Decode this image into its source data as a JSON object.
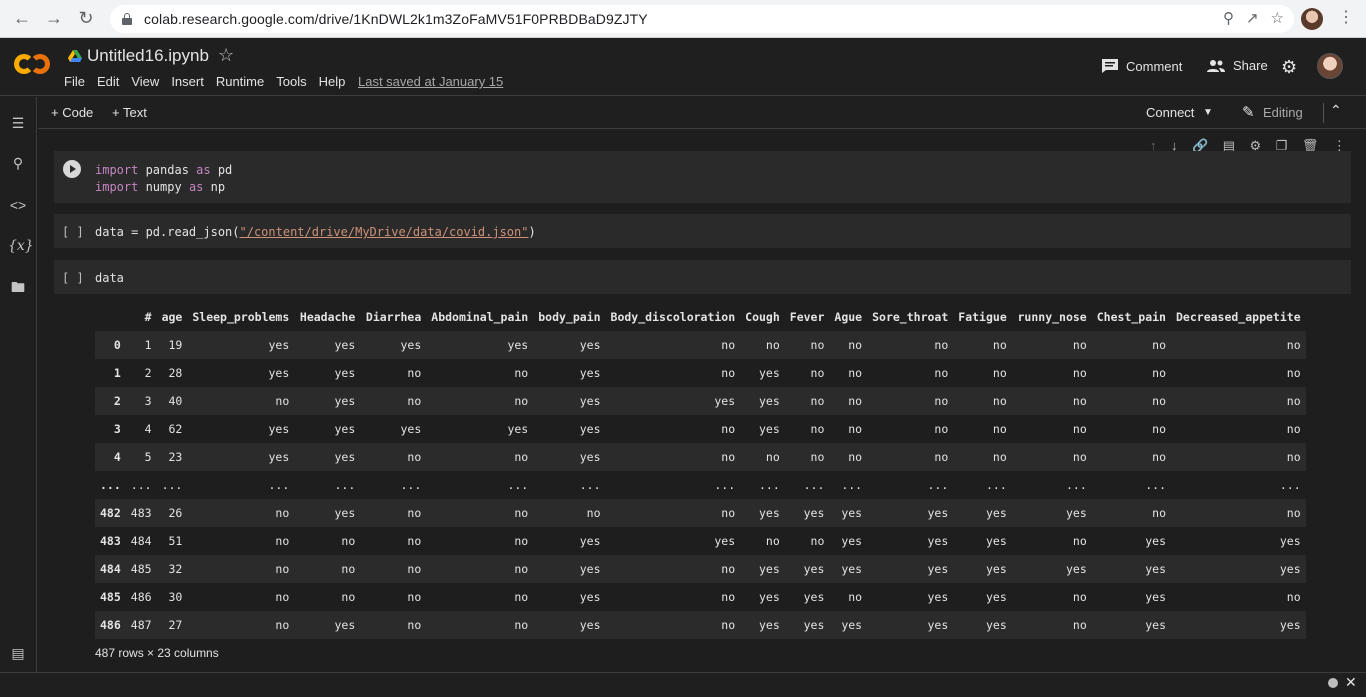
{
  "browser": {
    "url": "colab.research.google.com/drive/1KnDWL2k1m3ZoFaMV51F0PRBDBaD9ZJTY"
  },
  "notebook": {
    "title": "Untitled16.ipynb",
    "menu": [
      "File",
      "Edit",
      "View",
      "Insert",
      "Runtime",
      "Tools",
      "Help"
    ],
    "last_saved": "Last saved at January 15"
  },
  "header_actions": {
    "comment": "Comment",
    "share": "Share"
  },
  "toolbar": {
    "add_code": "+ Code",
    "add_text": "+ Text",
    "connect": "Connect",
    "editing": "Editing"
  },
  "cells": [
    {
      "exec": "",
      "lines": [
        "import pandas as pd",
        "import numpy as np"
      ]
    },
    {
      "exec": "[ ]",
      "code_prefix": "data = pd.read_json(",
      "code_string": "\"/content/drive/MyDrive/data/covid.json\"",
      "code_suffix": ")"
    },
    {
      "exec": "[ ]",
      "code": "data"
    }
  ],
  "dataframe": {
    "columns": [
      "",
      "#",
      "age",
      "Sleep_problems",
      "Headache",
      "Diarrhea",
      "Abdominal_pain",
      "body_pain",
      "Body_discoloration",
      "Cough",
      "Fever",
      "Ague",
      "Sore_throat",
      "Fatigue",
      "runny_nose",
      "Chest_pain",
      "Decreased_appetite"
    ],
    "rows": [
      [
        "0",
        "1",
        "19",
        "yes",
        "yes",
        "yes",
        "yes",
        "yes",
        "no",
        "no",
        "no",
        "no",
        "no",
        "no",
        "no",
        "no",
        "no"
      ],
      [
        "1",
        "2",
        "28",
        "yes",
        "yes",
        "no",
        "no",
        "yes",
        "no",
        "yes",
        "no",
        "no",
        "no",
        "no",
        "no",
        "no",
        "no"
      ],
      [
        "2",
        "3",
        "40",
        "no",
        "yes",
        "no",
        "no",
        "yes",
        "yes",
        "yes",
        "no",
        "no",
        "no",
        "no",
        "no",
        "no",
        "no"
      ],
      [
        "3",
        "4",
        "62",
        "yes",
        "yes",
        "yes",
        "yes",
        "yes",
        "no",
        "yes",
        "no",
        "no",
        "no",
        "no",
        "no",
        "no",
        "no"
      ],
      [
        "4",
        "5",
        "23",
        "yes",
        "yes",
        "no",
        "no",
        "yes",
        "no",
        "no",
        "no",
        "no",
        "no",
        "no",
        "no",
        "no",
        "no"
      ],
      [
        "...",
        "...",
        "...",
        "...",
        "...",
        "...",
        "...",
        "...",
        "...",
        "...",
        "...",
        "...",
        "...",
        "...",
        "...",
        "...",
        "..."
      ],
      [
        "482",
        "483",
        "26",
        "no",
        "yes",
        "no",
        "no",
        "no",
        "no",
        "yes",
        "yes",
        "yes",
        "yes",
        "yes",
        "yes",
        "no",
        "no"
      ],
      [
        "483",
        "484",
        "51",
        "no",
        "no",
        "no",
        "no",
        "yes",
        "yes",
        "no",
        "no",
        "yes",
        "yes",
        "yes",
        "no",
        "yes",
        "yes"
      ],
      [
        "484",
        "485",
        "32",
        "no",
        "no",
        "no",
        "no",
        "yes",
        "no",
        "yes",
        "yes",
        "yes",
        "yes",
        "yes",
        "yes",
        "yes",
        "yes"
      ],
      [
        "485",
        "486",
        "30",
        "no",
        "no",
        "no",
        "no",
        "yes",
        "no",
        "yes",
        "yes",
        "no",
        "yes",
        "yes",
        "no",
        "yes",
        "no"
      ],
      [
        "486",
        "487",
        "27",
        "no",
        "yes",
        "no",
        "no",
        "yes",
        "no",
        "yes",
        "yes",
        "yes",
        "yes",
        "yes",
        "no",
        "yes",
        "yes"
      ]
    ],
    "footer": "487 rows × 23 columns"
  },
  "colors": {
    "background": "#1e1e1e",
    "cell_background": "#2a2a2a",
    "keyword": "#c586c0",
    "string": "#ce9178",
    "logo_left": "#f9ab00",
    "logo_right": "#e8710a"
  }
}
